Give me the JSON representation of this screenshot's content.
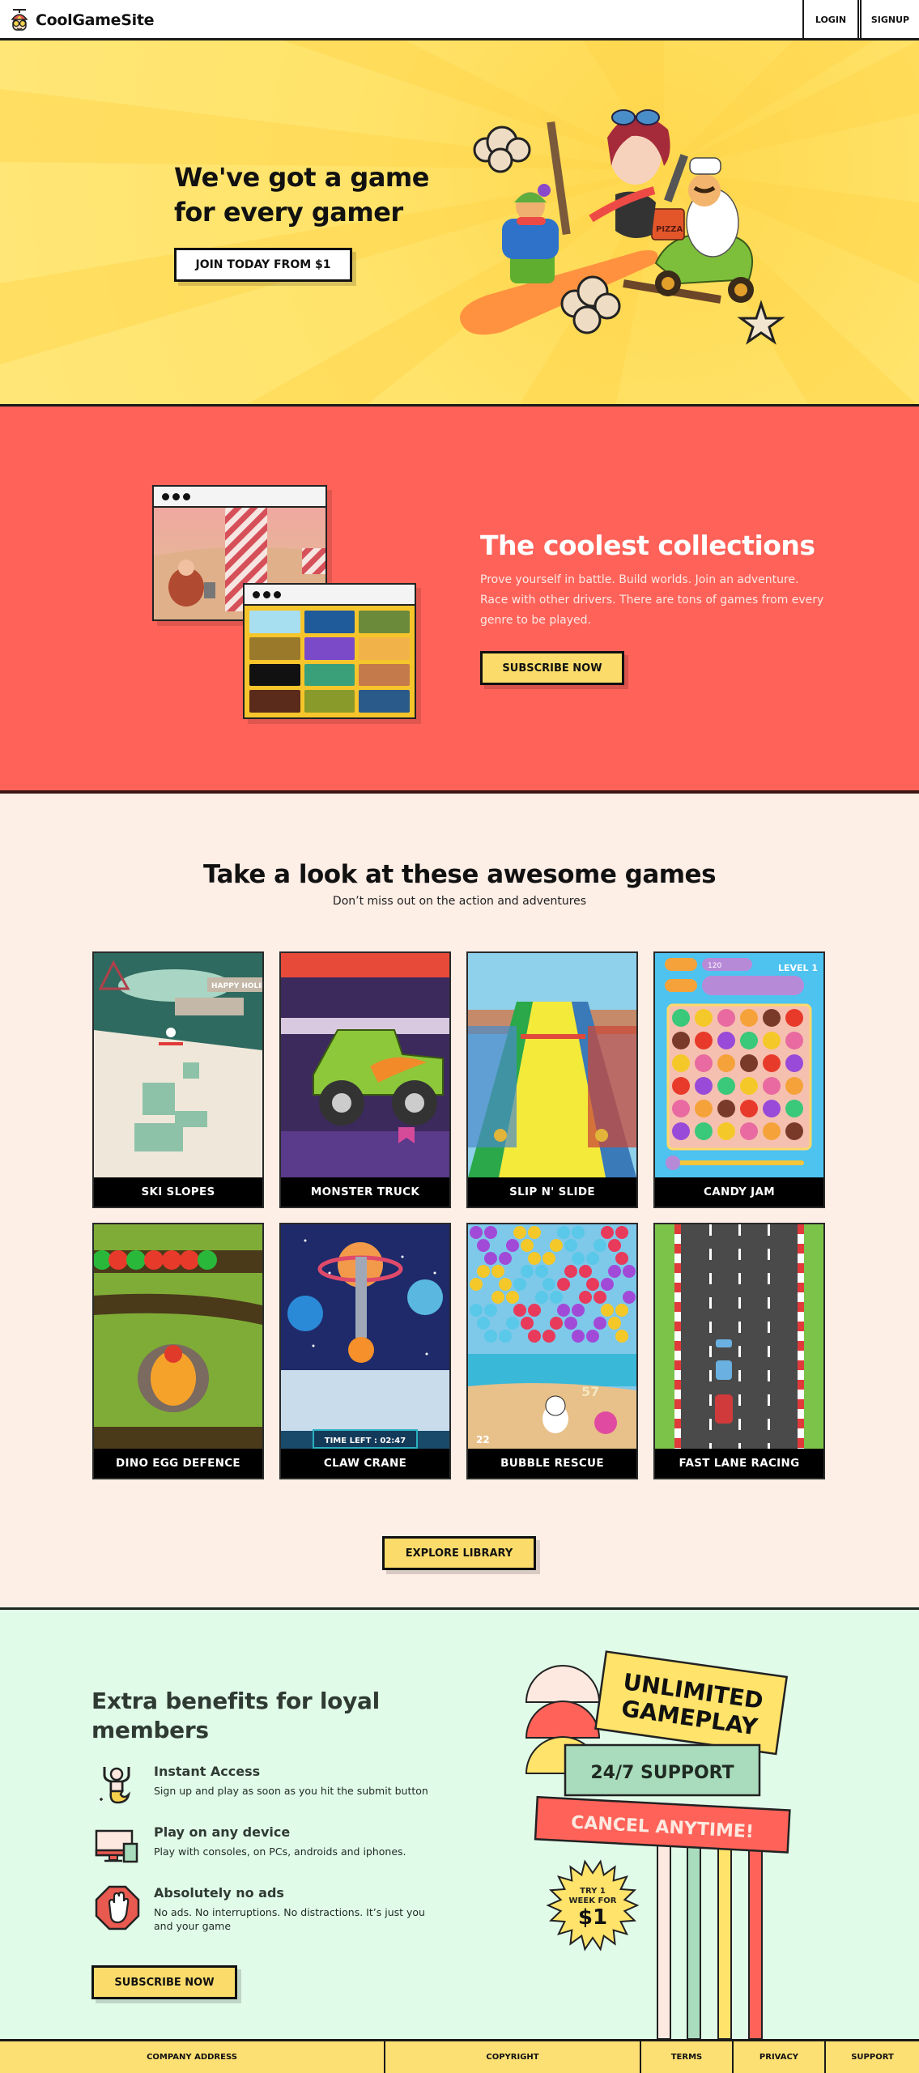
{
  "header": {
    "brand": "CoolGameSite",
    "nav": [
      {
        "label": "LOGIN"
      },
      {
        "label": "SIGNUP"
      }
    ]
  },
  "hero": {
    "title_line1": "We've got a game",
    "title_line2": "for every gamer",
    "cta_label": "JOIN TODAY FROM $1",
    "art_label": "PIZZA"
  },
  "collections": {
    "title": "The coolest collections",
    "description": "Prove yourself in battle. Build worlds. Join an adventure. Race with other drivers. There are tons of games from every genre to be played.",
    "cta_label": "SUBSCRIBE NOW"
  },
  "games": {
    "title": "Take a look at these awesome games",
    "subtitle": "Don’t miss out on the action and adventures",
    "items": [
      {
        "title": "SKI SLOPES",
        "art_text": "HAPPY HOLIDA"
      },
      {
        "title": "MONSTER TRUCK"
      },
      {
        "title": "SLIP N' SLIDE"
      },
      {
        "title": "CANDY JAM",
        "art_text": "LEVEL 1",
        "score": "120"
      },
      {
        "title": "DINO EGG DEFENCE"
      },
      {
        "title": "CLAW CRANE",
        "art_text": "TIME LEFT : 02:47"
      },
      {
        "title": "BUBBLE RESCUE",
        "art_text": "57",
        "count": "22"
      },
      {
        "title": "FAST LANE RACING"
      }
    ],
    "explore_label": "EXPLORE LIBRARY"
  },
  "benefits": {
    "title": "Extra benefits for loyal members",
    "items": [
      {
        "icon": "cheering-person-icon",
        "title": "Instant Access",
        "text": "Sign up and play as soon as you hit the submit button"
      },
      {
        "icon": "devices-icon",
        "title": "Play on any device",
        "text": "Play with consoles, on PCs, androids and iphones."
      },
      {
        "icon": "no-ads-hand-icon",
        "title": "Absolutely no ads",
        "text": "No ads. No interruptions. No distractions. It’s just you and your game"
      }
    ],
    "cta_label": "SUBSCRIBE NOW",
    "signs": {
      "sign1_line1": "UNLIMITED",
      "sign1_line2": "GAMEPLAY",
      "sign2": "24/7 SUPPORT",
      "sign3": "CANCEL ANYTIME!",
      "badge_line1": "TRY 1",
      "badge_line2": "WEEK FOR",
      "badge_price": "$1"
    }
  },
  "footer": {
    "links": [
      {
        "label": "COMPANY ADDRESS"
      },
      {
        "label": "COPYRIGHT"
      },
      {
        "label": "TERMS"
      },
      {
        "label": "PRIVACY"
      },
      {
        "label": "SUPPORT"
      }
    ]
  },
  "colors": {
    "yellow": "#ffe36a",
    "coral": "#fe6259",
    "cream": "#fdeee6",
    "mint": "#e1fbe9",
    "button_yellow": "#fbdc6b",
    "sign_green": "#a8dcbc"
  }
}
